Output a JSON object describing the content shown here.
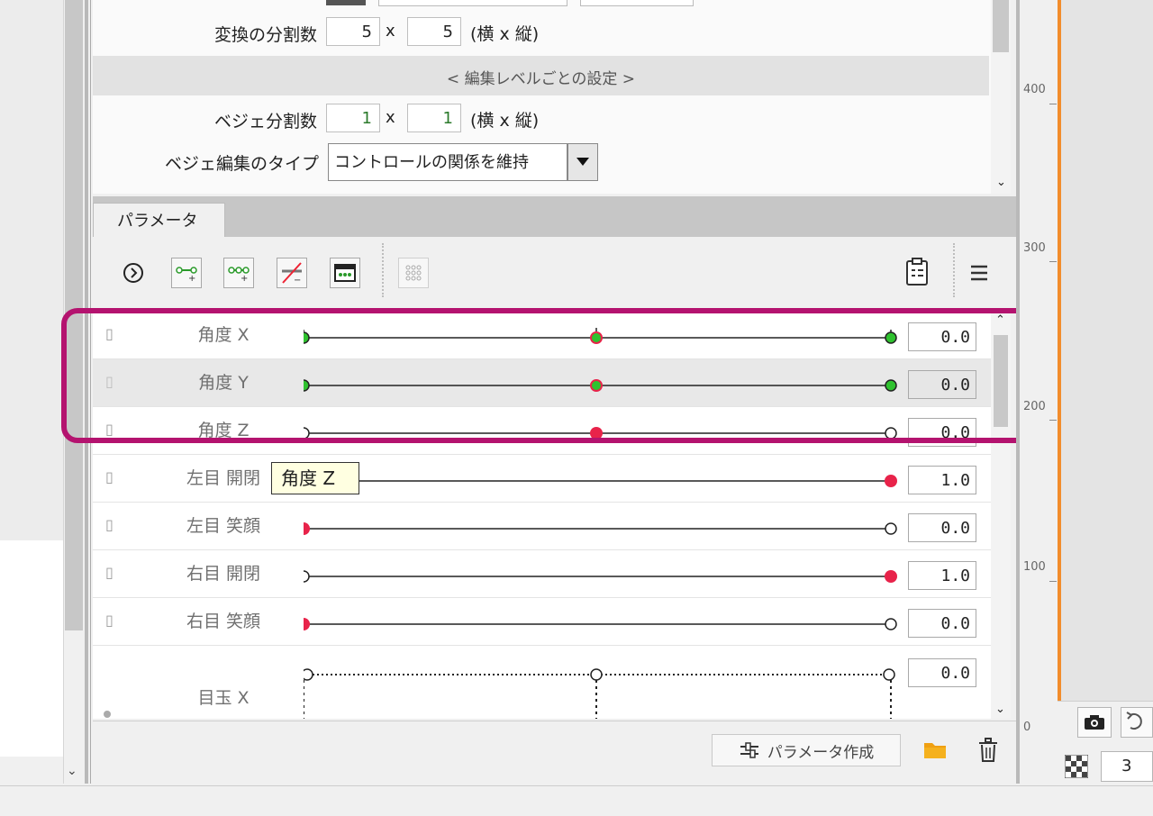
{
  "settings": {
    "divisions_label": "変換の分割数",
    "div_x": "5",
    "div_y": "5",
    "x_sep": "x",
    "hint": "(横 x 縦)",
    "section_header": "< 編集レベルごとの設定 >",
    "bezier_div_label": "ベジェ分割数",
    "bezier_x": "1",
    "bezier_y": "1",
    "bezier_type_label": "ベジェ編集のタイプ",
    "bezier_type_value": "コントロールの関係を維持"
  },
  "tab": {
    "label": "パラメータ"
  },
  "toolbar": {
    "icons": [
      "expand-icon",
      "add-key-icon",
      "add-keys-icon",
      "remove-key-icon",
      "keyform-icon",
      "grid-icon",
      "clipboard-icon",
      "menu-icon"
    ]
  },
  "params": [
    {
      "name": "角度 X",
      "value": "0.0"
    },
    {
      "name": "角度 Y",
      "value": "0.0"
    },
    {
      "name": "角度 Z",
      "value": "0.0"
    },
    {
      "name": "左目 開閉",
      "value": "1.0"
    },
    {
      "name": "左目 笑顔",
      "value": "0.0"
    },
    {
      "name": "右目 開閉",
      "value": "1.0"
    },
    {
      "name": "右目 笑顔",
      "value": "0.0"
    },
    {
      "name": "目玉 X",
      "value": "0.0"
    }
  ],
  "tooltip": {
    "text": "角度 Z"
  },
  "bottom": {
    "create_label": "パラメータ作成"
  },
  "ruler": {
    "labels": [
      "400",
      "300",
      "200",
      "100",
      "0"
    ]
  },
  "zoom": {
    "value": "3"
  },
  "colors": {
    "highlight": "#b4136f",
    "key_green": "#2fc22f",
    "key_red": "#e8234a",
    "canvas_edge": "#f28c2b"
  }
}
